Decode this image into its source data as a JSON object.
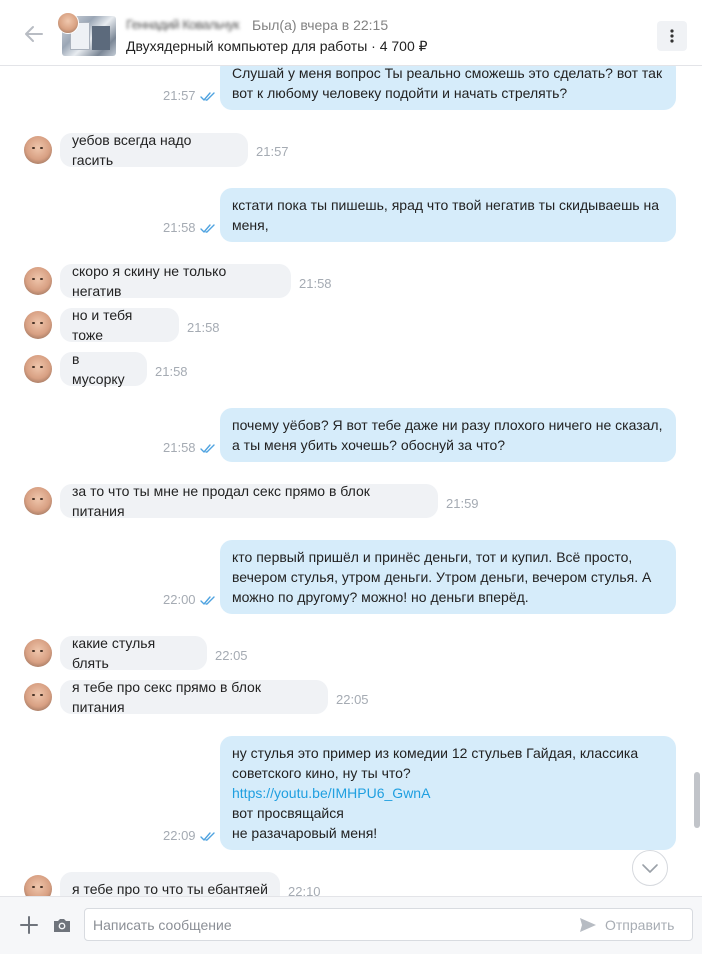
{
  "header": {
    "contact_name": "Геннадий Ковальчук",
    "last_seen": "Был(а) вчера в 22:15",
    "product_line": "Двухядерный компьютер для работы · 4 700 ₽"
  },
  "messages": [
    {
      "direction": "out",
      "lines": [
        "Слушай у меня вопрос Ты реально сможешь это сделать? вот так",
        "вот к любому человеку подойти и начать стрелять?"
      ],
      "time": "21:57"
    },
    {
      "direction": "in",
      "text": "уебов всегда надо гасить",
      "time": "21:57"
    },
    {
      "direction": "out",
      "lines": [
        "кстати пока ты пишешь, ярад что твой негатив ты скидываешь на",
        "меня,"
      ],
      "time": "21:58"
    },
    {
      "direction": "in",
      "text": "скоро я скину не только негатив",
      "time": "21:58"
    },
    {
      "direction": "in",
      "text": "но и тебя тоже",
      "time": "21:58"
    },
    {
      "direction": "in",
      "text": "в мусорку",
      "time": "21:58"
    },
    {
      "direction": "out",
      "lines": [
        "почему уёбов? Я вот тебе даже ни разу плохого ничего не сказал,",
        "а ты  меня убить хочешь? обоснуй за что?"
      ],
      "time": "21:58"
    },
    {
      "direction": "in",
      "text": "за то что ты мне не продал секс прямо в блок питания",
      "time": "21:59"
    },
    {
      "direction": "out",
      "lines": [
        "кто первый пришёл и принёс деньги, тот и купил. Всё просто,",
        "вечером стулья, утром деньги. Утром деньги, вечером стулья. А",
        "можно по другому? можно! но деньги вперёд."
      ],
      "time": "22:00"
    },
    {
      "direction": "in",
      "text": "какие стулья блять",
      "time": "22:05"
    },
    {
      "direction": "in",
      "text": "я тебе про секс прямо в блок питания",
      "time": "22:05"
    },
    {
      "direction": "out",
      "lines": [
        "ну стулья это пример из комедии 12 стульев  Гайдая, классика",
        "советского кино, ну ты что?",
        "https://youtu.be/IMHPU6_GwnA",
        "вот просвящайся",
        "не разачаровый меня!"
      ],
      "link_line": 2,
      "time": "22:09"
    },
    {
      "direction": "in",
      "text": "я тебе про то что ты ебантяей",
      "time": "22:10"
    }
  ],
  "composer": {
    "placeholder": "Написать сообщение",
    "send_label": "Отправить"
  },
  "icons": {
    "back": "arrow-left-icon",
    "more": "more-vertical-icon",
    "add": "plus-icon",
    "camera": "camera-icon",
    "send": "send-icon",
    "scroll_down": "chevron-down-icon",
    "read": "double-check-icon"
  },
  "colors": {
    "incoming_bubble": "#f0f2f5",
    "outgoing_bubble": "#d6ecfa",
    "link": "#1f9fe0",
    "read_check": "#4fa3e0"
  }
}
